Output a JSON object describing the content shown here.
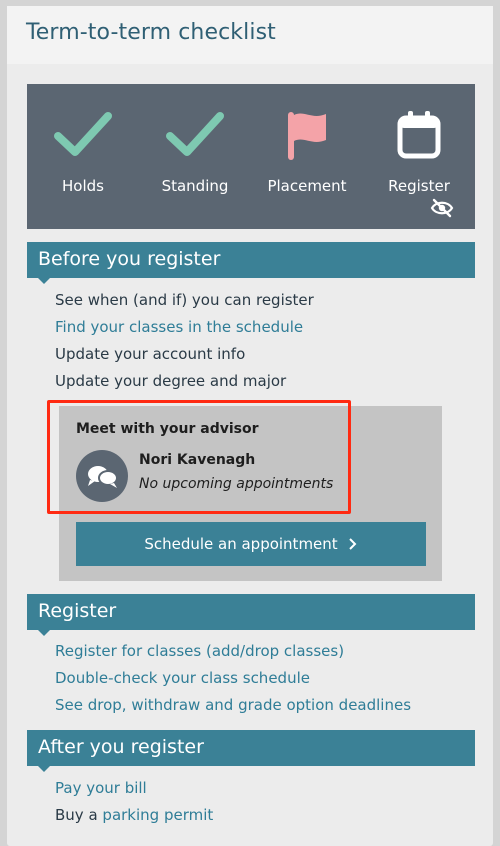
{
  "page": {
    "title": "Term-to-term checklist"
  },
  "status": {
    "items": [
      {
        "label": "Holds",
        "icon": "checkmark-icon",
        "color": "#7ec9b1"
      },
      {
        "label": "Standing",
        "icon": "checkmark-icon",
        "color": "#7ec9b1"
      },
      {
        "label": "Placement",
        "icon": "flag-icon",
        "color": "#f4a3a8"
      },
      {
        "label": "Register",
        "icon": "calendar-icon",
        "color": "#ffffff"
      }
    ],
    "hidden_icon": "eye-off-icon"
  },
  "before": {
    "title": "Before you register",
    "links": [
      {
        "text": "See when (and if) you can register"
      },
      {
        "text": "Find your classes in the schedule"
      },
      {
        "text": "Update your account info"
      },
      {
        "text": "Update your degree and major"
      }
    ]
  },
  "advisor": {
    "heading": "Meet with your advisor",
    "name": "Nori Kavenagh",
    "note": "No upcoming appointments",
    "button_label": "Schedule an appointment",
    "button_icon": "chevron-right-icon",
    "avatar_icon": "chat-bubbles-icon"
  },
  "register": {
    "title": "Register",
    "links": [
      {
        "text": "Register for classes (add/drop classes)"
      },
      {
        "text": "Double-check your class schedule"
      },
      {
        "text": "See drop, withdraw and grade option deadlines"
      }
    ]
  },
  "after": {
    "title": "After you register",
    "links": [
      {
        "text": "Pay your bill"
      }
    ],
    "parking_prefix": "Buy a",
    "parking_link": "parking permit"
  },
  "colors": {
    "accent": "#3b8196",
    "panel": "#5b6672",
    "highlight": "#ff2a12"
  }
}
